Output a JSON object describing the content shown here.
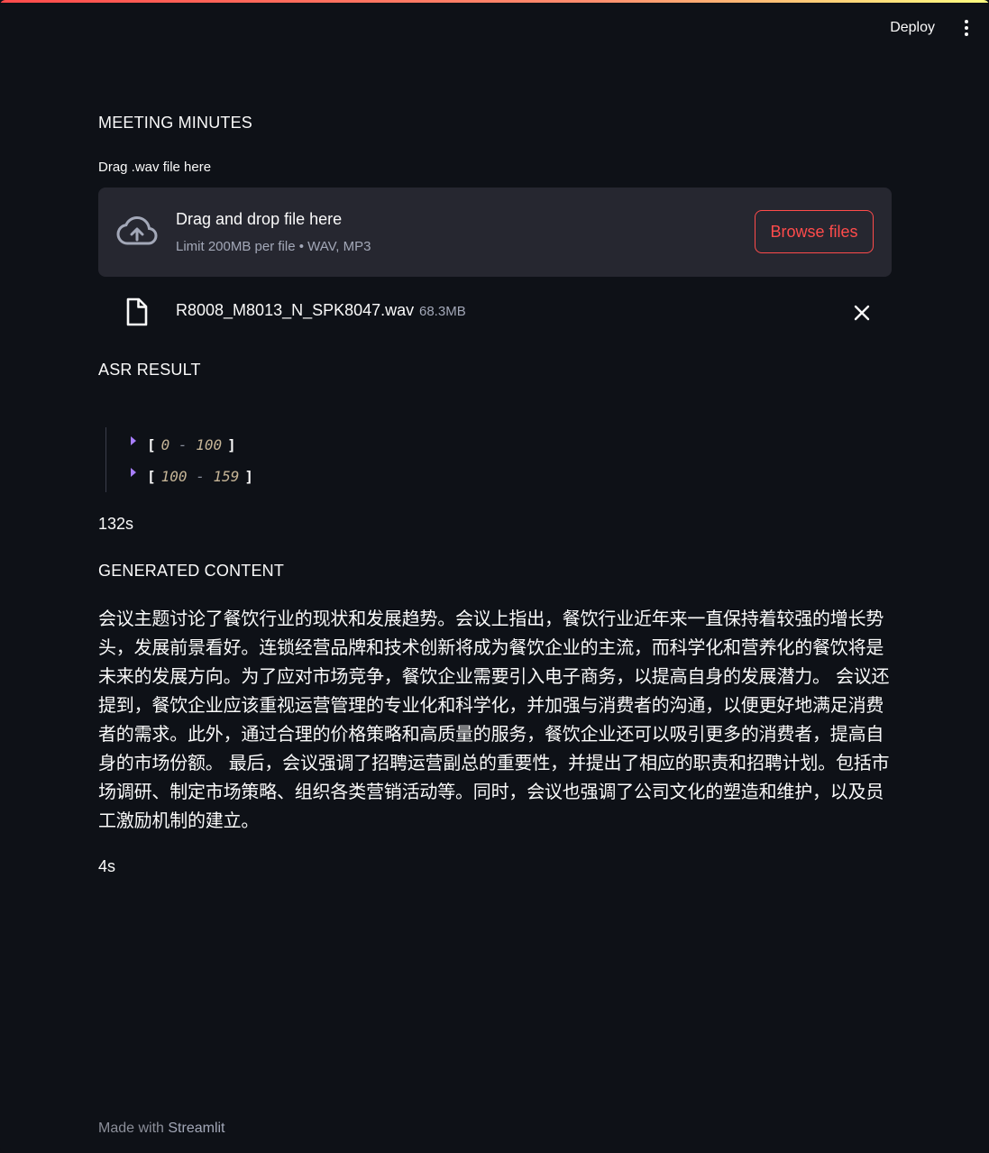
{
  "header": {
    "deploy_label": "Deploy",
    "menu_icon": "kebab-menu-icon"
  },
  "main": {
    "title": "MEETING MINUTES",
    "uploader": {
      "label": "Drag .wav file here",
      "dropzone_title": "Drag and drop file here",
      "dropzone_limit": "Limit 200MB per file • WAV, MP3",
      "browse_label": "Browse files",
      "cloud_icon": "cloud-upload-icon"
    },
    "uploaded_file": {
      "name": "R8008_M8013_N_SPK8047.wav",
      "size": "68.3MB",
      "file_icon": "file-icon",
      "remove_icon": "close-icon"
    },
    "asr_heading": "ASR RESULT",
    "asr_items": [
      {
        "open": "[",
        "start": "0",
        "dash": "-",
        "end": "100",
        "close": "]"
      },
      {
        "open": "[",
        "start": "100",
        "dash": "-",
        "end": "159",
        "close": "]"
      }
    ],
    "asr_time": "132s",
    "generated_heading": "GENERATED CONTENT",
    "generated_text": "会议主题讨论了餐饮行业的现状和发展趋势。会议上指出，餐饮行业近年来一直保持着较强的增长势头，发展前景看好。连锁经营品牌和技术创新将成为餐饮企业的主流，而科学化和营养化的餐饮将是未来的发展方向。为了应对市场竞争，餐饮企业需要引入电子商务，以提高自身的发展潜力。 会议还提到，餐饮企业应该重视运营管理的专业化和科学化，并加强与消费者的沟通，以便更好地满足消费者的需求。此外，通过合理的价格策略和高质量的服务，餐饮企业还可以吸引更多的消费者，提高自身的市场份额。 最后，会议强调了招聘运营副总的重要性，并提出了相应的职责和招聘计划。包括市场调研、制定市场策略、组织各类营销活动等。同时，会议也强调了公司文化的塑造和维护，以及员工激励机制的建立。",
    "generated_time": "4s"
  },
  "footer": {
    "prefix": "Made with",
    "brand": "Streamlit"
  },
  "colors": {
    "background": "#0e1117",
    "dropzone": "#262730",
    "accent": "#ff4b4b",
    "muted": "#a3a8b8",
    "caret": "#a87eff"
  }
}
